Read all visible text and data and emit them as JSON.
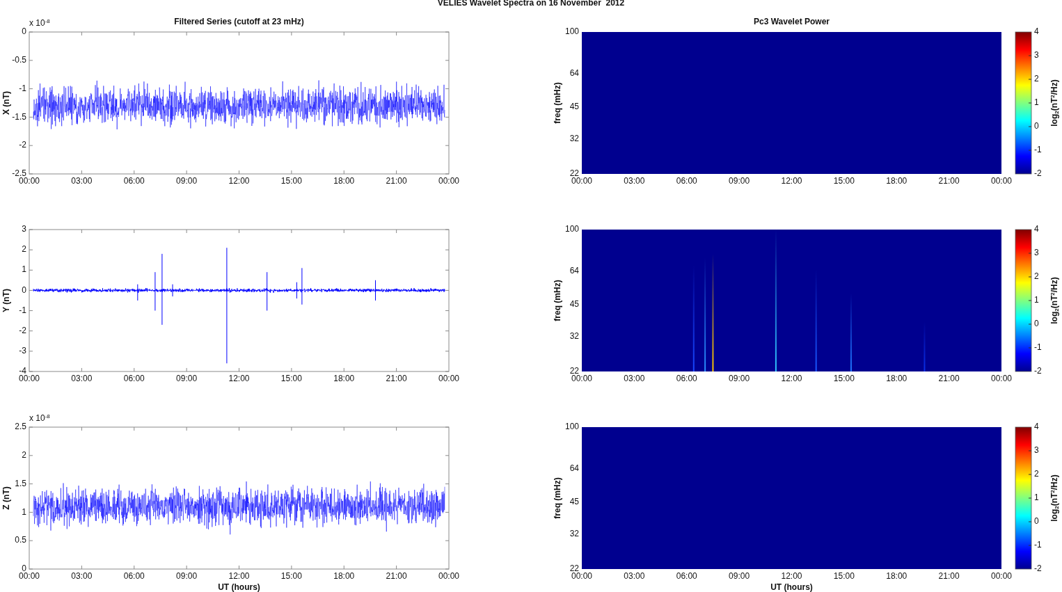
{
  "figure_title": "VELIES Wavelet Spectra on 16 November  2012",
  "series_panels": [
    {
      "title": "Filtered Series (cutoff at 23 mHz)",
      "ylabel": "X (nT)",
      "exponent": "x 10$^{-8}$",
      "kind": "noise",
      "yticks": [
        "0",
        "-0.5",
        "-1",
        "-1.5",
        "-2",
        "-2.5"
      ],
      "xticks": [
        "00:00",
        "03:00",
        "06:00",
        "09:00",
        "12:00",
        "15:00",
        "18:00",
        "21:00",
        "00:00"
      ]
    },
    {
      "ylabel": "Y (nT)",
      "kind": "spiky",
      "yticks": [
        "3",
        "2",
        "1",
        "0",
        "-1",
        "-2",
        "-3",
        "-4"
      ],
      "xticks": [
        "00:00",
        "03:00",
        "06:00",
        "09:00",
        "12:00",
        "15:00",
        "18:00",
        "21:00",
        "00:00"
      ]
    },
    {
      "ylabel": "Z (nT)",
      "exponent": "x 10$^{-8}$",
      "kind": "noise",
      "yticks": [
        "2.5",
        "2",
        "1.5",
        "1",
        "0.5",
        "0"
      ],
      "xticks": [
        "00:00",
        "03:00",
        "06:00",
        "09:00",
        "12:00",
        "15:00",
        "18:00",
        "21:00",
        "00:00"
      ],
      "xlabel": "UT (hours)"
    }
  ],
  "spectra_panels": [
    {
      "title": "Pc3 Wavelet Power",
      "ylabel": "freq (mHz)",
      "kind": "quiet",
      "yticks": [
        "100",
        "64",
        "45",
        "32",
        "22"
      ],
      "xticks": [
        "00:00",
        "03:00",
        "06:00",
        "09:00",
        "12:00",
        "15:00",
        "18:00",
        "21:00",
        "00:00"
      ],
      "colorbar": {
        "ticks": [
          "4",
          "3",
          "2",
          "1",
          "0",
          "-1",
          "-2"
        ],
        "label": "log$_{2}$(nT$^{2}$/Hz)"
      }
    },
    {
      "ylabel": "freq (mHz)",
      "kind": "bursts",
      "yticks": [
        "100",
        "64",
        "45",
        "32",
        "22"
      ],
      "xticks": [
        "00:00",
        "03:00",
        "06:00",
        "09:00",
        "12:00",
        "15:00",
        "18:00",
        "21:00",
        "00:00"
      ],
      "colorbar": {
        "ticks": [
          "4",
          "3",
          "2",
          "1",
          "0",
          "-1",
          "-2"
        ],
        "label": "log$_{2}$(nT$^{2}$/Hz)"
      }
    },
    {
      "ylabel": "freq (mHz)",
      "kind": "quiet",
      "yticks": [
        "100",
        "64",
        "45",
        "32",
        "22"
      ],
      "xticks": [
        "00:00",
        "03:00",
        "06:00",
        "09:00",
        "12:00",
        "15:00",
        "18:00",
        "21:00",
        "00:00"
      ],
      "colorbar": {
        "ticks": [
          "4",
          "3",
          "2",
          "1",
          "0",
          "-1",
          "-2"
        ],
        "label": "log$_{2}$(nT$^{2}$/Hz)"
      },
      "xlabel": "UT (hours)"
    }
  ]
}
